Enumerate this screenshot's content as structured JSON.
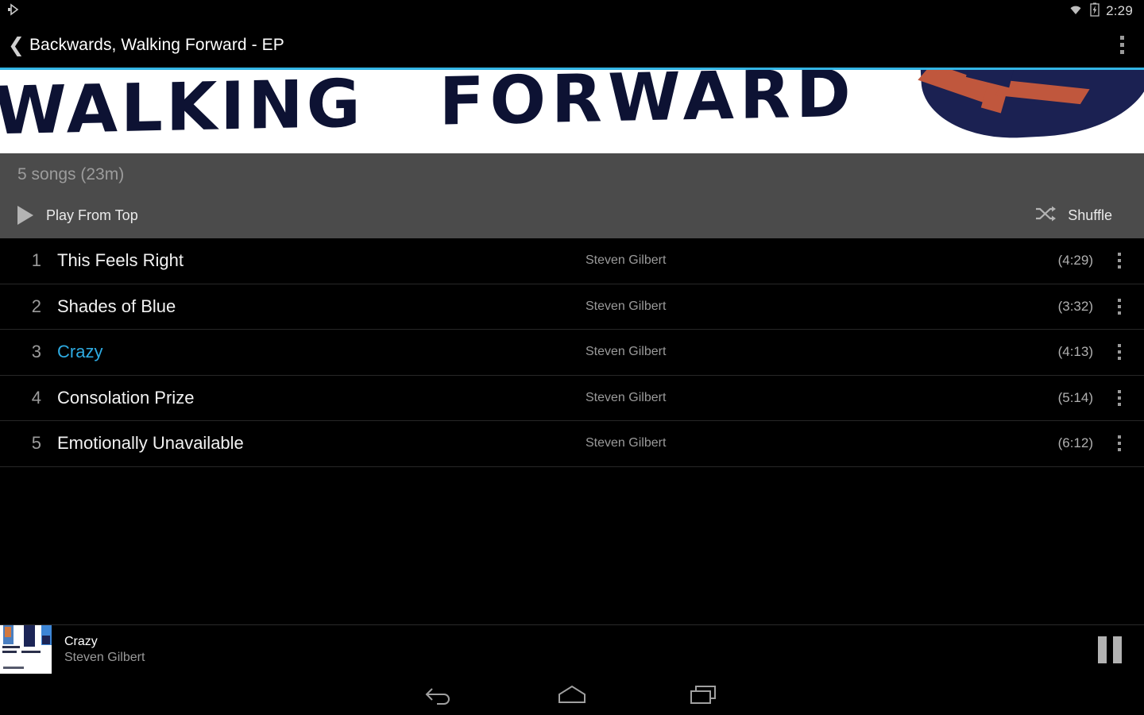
{
  "status_bar": {
    "notification_icon": "play-notification-icon",
    "wifi_icon": "wifi-icon",
    "battery_icon": "battery-charging-icon",
    "time": "2:29"
  },
  "action_bar": {
    "back_icon": "back-chevron-icon",
    "title": "Backwards, Walking Forward - EP",
    "overflow_icon": "overflow-menu-icon"
  },
  "banner": {
    "word1": "WALKING",
    "word2": "FORWARD",
    "artwork_colors": {
      "background": "#ffffff",
      "ink": "#0d1233",
      "accent": "#c0573d"
    }
  },
  "album_header": {
    "song_count": "5 songs (23m)",
    "play_from_top_label": "Play From Top",
    "play_icon": "play-triangle-icon",
    "shuffle_label": "Shuffle",
    "shuffle_icon": "shuffle-icon",
    "background": "#4b4b4b"
  },
  "tracks": [
    {
      "num": "1",
      "title": "This Feels Right",
      "artist": "Steven Gilbert",
      "duration": "(4:29)",
      "current": false
    },
    {
      "num": "2",
      "title": "Shades of Blue",
      "artist": "Steven Gilbert",
      "duration": "(3:32)",
      "current": false
    },
    {
      "num": "3",
      "title": "Crazy",
      "artist": "Steven Gilbert",
      "duration": "(4:13)",
      "current": true
    },
    {
      "num": "4",
      "title": "Consolation Prize",
      "artist": "Steven Gilbert",
      "duration": "(5:14)",
      "current": false
    },
    {
      "num": "5",
      "title": "Emotionally Unavailable",
      "artist": "Steven Gilbert",
      "duration": "(6:12)",
      "current": false
    }
  ],
  "mini_player": {
    "album_art": "album-art-thumbnail",
    "title": "Crazy",
    "artist": "Steven Gilbert",
    "transport_icon": "pause-icon"
  },
  "nav_bar": {
    "back_icon": "nav-back-icon",
    "home_icon": "nav-home-icon",
    "recents_icon": "nav-recents-icon"
  },
  "accent_color": "#33b5e5",
  "current_track_color": "#2eabe2"
}
